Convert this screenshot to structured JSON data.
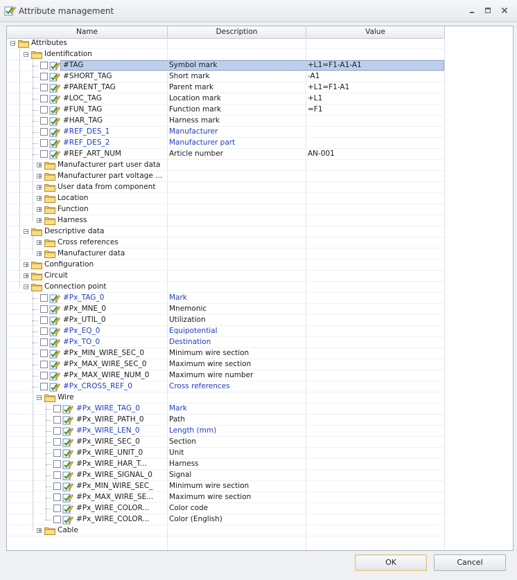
{
  "window": {
    "title": "Attribute management",
    "controls": [
      "minimize-icon",
      "maximize-icon",
      "close-icon"
    ]
  },
  "columns": {
    "name": "Name",
    "description": "Description",
    "value": "Value"
  },
  "rows": [
    {
      "id": "attributes",
      "depth": 0,
      "type": "folder",
      "expanded": true,
      "name": "Attributes",
      "desc": "",
      "value": ""
    },
    {
      "id": "identification",
      "depth": 1,
      "type": "folder",
      "expanded": true,
      "name": "Identification",
      "desc": "",
      "value": ""
    },
    {
      "id": "tag",
      "depth": 2,
      "type": "attr",
      "name": "#TAG",
      "desc": "Symbol mark",
      "value": "+L1=F1-A1-A1",
      "selected": true
    },
    {
      "id": "short-tag",
      "depth": 2,
      "type": "attr",
      "name": "#SHORT_TAG",
      "desc": "Short mark",
      "value": "-A1"
    },
    {
      "id": "parent-tag",
      "depth": 2,
      "type": "attr",
      "name": "#PARENT_TAG",
      "desc": "Parent mark",
      "value": "+L1=F1-A1"
    },
    {
      "id": "loc-tag",
      "depth": 2,
      "type": "attr",
      "name": "#LOC_TAG",
      "desc": "Location mark",
      "value": "+L1"
    },
    {
      "id": "fun-tag",
      "depth": 2,
      "type": "attr",
      "name": "#FUN_TAG",
      "desc": "Function mark",
      "value": "=F1"
    },
    {
      "id": "har-tag",
      "depth": 2,
      "type": "attr",
      "name": "#HAR_TAG",
      "desc": "Harness mark",
      "value": ""
    },
    {
      "id": "ref-des-1",
      "depth": 2,
      "type": "attr",
      "name": "#REF_DES_1",
      "desc": "Manufacturer",
      "value": "",
      "blue": true
    },
    {
      "id": "ref-des-2",
      "depth": 2,
      "type": "attr",
      "name": "#REF_DES_2",
      "desc": "Manufacturer part",
      "value": "",
      "blue": true
    },
    {
      "id": "ref-art-num",
      "depth": 2,
      "type": "attr",
      "name": "#REF_ART_NUM",
      "desc": "Article number",
      "value": "AN-001"
    },
    {
      "id": "mfr-part-user",
      "depth": 2,
      "type": "folder",
      "expanded": false,
      "name": "Manufacturer part user data",
      "desc": "",
      "value": ""
    },
    {
      "id": "mfr-part-voltage",
      "depth": 2,
      "type": "folder",
      "expanded": false,
      "name": "Manufacturer part voltage ...",
      "desc": "",
      "value": ""
    },
    {
      "id": "user-data-component",
      "depth": 2,
      "type": "folder",
      "expanded": false,
      "name": "User data from component",
      "desc": "",
      "value": ""
    },
    {
      "id": "location",
      "depth": 2,
      "type": "folder",
      "expanded": false,
      "name": "Location",
      "desc": "",
      "value": ""
    },
    {
      "id": "function",
      "depth": 2,
      "type": "folder",
      "expanded": false,
      "name": "Function",
      "desc": "",
      "value": ""
    },
    {
      "id": "harness",
      "depth": 2,
      "type": "folder",
      "expanded": false,
      "name": "Harness",
      "desc": "",
      "value": ""
    },
    {
      "id": "descriptive-data",
      "depth": 1,
      "type": "folder",
      "expanded": true,
      "name": "Descriptive data",
      "desc": "",
      "value": ""
    },
    {
      "id": "cross-references",
      "depth": 2,
      "type": "folder",
      "expanded": false,
      "name": "Cross references",
      "desc": "",
      "value": ""
    },
    {
      "id": "manufacturer-data",
      "depth": 2,
      "type": "folder",
      "expanded": false,
      "name": "Manufacturer data",
      "desc": "",
      "value": ""
    },
    {
      "id": "configuration",
      "depth": 1,
      "type": "folder",
      "expanded": false,
      "name": "Configuration",
      "desc": "",
      "value": ""
    },
    {
      "id": "circuit",
      "depth": 1,
      "type": "folder",
      "expanded": false,
      "name": "Circuit",
      "desc": "",
      "value": ""
    },
    {
      "id": "connection-point",
      "depth": 1,
      "type": "folder",
      "expanded": true,
      "name": "Connection point",
      "desc": "",
      "value": ""
    },
    {
      "id": "px-tag-0",
      "depth": 2,
      "type": "attr",
      "name": "#Px_TAG_0",
      "desc": "Mark",
      "value": "",
      "blue": true
    },
    {
      "id": "px-mne-0",
      "depth": 2,
      "type": "attr",
      "name": "#Px_MNE_0",
      "desc": "Mnemonic",
      "value": ""
    },
    {
      "id": "px-util-0",
      "depth": 2,
      "type": "attr",
      "name": "#Px_UTIL_0",
      "desc": "Utilization",
      "value": ""
    },
    {
      "id": "px-eq-0",
      "depth": 2,
      "type": "attr",
      "name": "#Px_EQ_0",
      "desc": "Equipotential",
      "value": "",
      "blue": true
    },
    {
      "id": "px-to-0",
      "depth": 2,
      "type": "attr",
      "name": "#Px_TO_0",
      "desc": "Destination",
      "value": "",
      "blue": true
    },
    {
      "id": "px-min-wire-sec-0",
      "depth": 2,
      "type": "attr",
      "name": "#Px_MIN_WIRE_SEC_0",
      "desc": "Minimum wire section",
      "value": ""
    },
    {
      "id": "px-max-wire-sec-0",
      "depth": 2,
      "type": "attr",
      "name": "#Px_MAX_WIRE_SEC_0",
      "desc": "Maximum wire section",
      "value": ""
    },
    {
      "id": "px-max-wire-num-0",
      "depth": 2,
      "type": "attr",
      "name": "#Px_MAX_WIRE_NUM_0",
      "desc": "Maximum wire number",
      "value": ""
    },
    {
      "id": "px-cross-ref-0",
      "depth": 2,
      "type": "attr",
      "name": "#Px_CROSS_REF_0",
      "desc": "Cross references",
      "value": "",
      "blue": true
    },
    {
      "id": "wire",
      "depth": 2,
      "type": "folder",
      "expanded": true,
      "name": "Wire",
      "desc": "",
      "value": ""
    },
    {
      "id": "px-wire-tag-0",
      "depth": 3,
      "type": "attr",
      "name": "#Px_WIRE_TAG_0",
      "desc": "Mark",
      "value": "",
      "blue": true
    },
    {
      "id": "px-wire-path-0",
      "depth": 3,
      "type": "attr",
      "name": "#Px_WIRE_PATH_0",
      "desc": "Path",
      "value": ""
    },
    {
      "id": "px-wire-len-0",
      "depth": 3,
      "type": "attr",
      "name": "#Px_WIRE_LEN_0",
      "desc": "Length (mm)",
      "value": "",
      "blue": true
    },
    {
      "id": "px-wire-sec-0",
      "depth": 3,
      "type": "attr",
      "name": "#Px_WIRE_SEC_0",
      "desc": "Section",
      "value": ""
    },
    {
      "id": "px-wire-unit-0",
      "depth": 3,
      "type": "attr",
      "name": "#Px_WIRE_UNIT_0",
      "desc": "Unit",
      "value": ""
    },
    {
      "id": "px-wire-har",
      "depth": 3,
      "type": "attr",
      "name": "#Px_WIRE_HAR_T...",
      "desc": "Harness",
      "value": ""
    },
    {
      "id": "px-wire-signal-0",
      "depth": 3,
      "type": "attr",
      "name": "#Px_WIRE_SIGNAL_0",
      "desc": "Signal",
      "value": ""
    },
    {
      "id": "px-min-wire-sec-w",
      "depth": 3,
      "type": "attr",
      "name": "#Px_MIN_WIRE_SEC_",
      "desc": "Minimum wire section",
      "value": ""
    },
    {
      "id": "px-max-wire-sec-w",
      "depth": 3,
      "type": "attr",
      "name": "#Px_MAX_WIRE_SE...",
      "desc": "Maximum wire section",
      "value": ""
    },
    {
      "id": "px-wire-color-code",
      "depth": 3,
      "type": "attr",
      "name": "#Px_WIRE_COLOR...",
      "desc": "Color code",
      "value": ""
    },
    {
      "id": "px-wire-color-en",
      "depth": 3,
      "type": "attr",
      "name": "#Px_WIRE_COLOR...",
      "desc": "Color (English)",
      "value": ""
    },
    {
      "id": "cable",
      "depth": 2,
      "type": "folder",
      "expanded": false,
      "name": "Cable",
      "desc": "",
      "value": ""
    }
  ],
  "buttons": {
    "ok": "OK",
    "cancel": "Cancel"
  },
  "colors": {
    "accent_blue": "#1f3cc2",
    "selection": "#bcd0ee",
    "folder": "#f2cf6a"
  }
}
